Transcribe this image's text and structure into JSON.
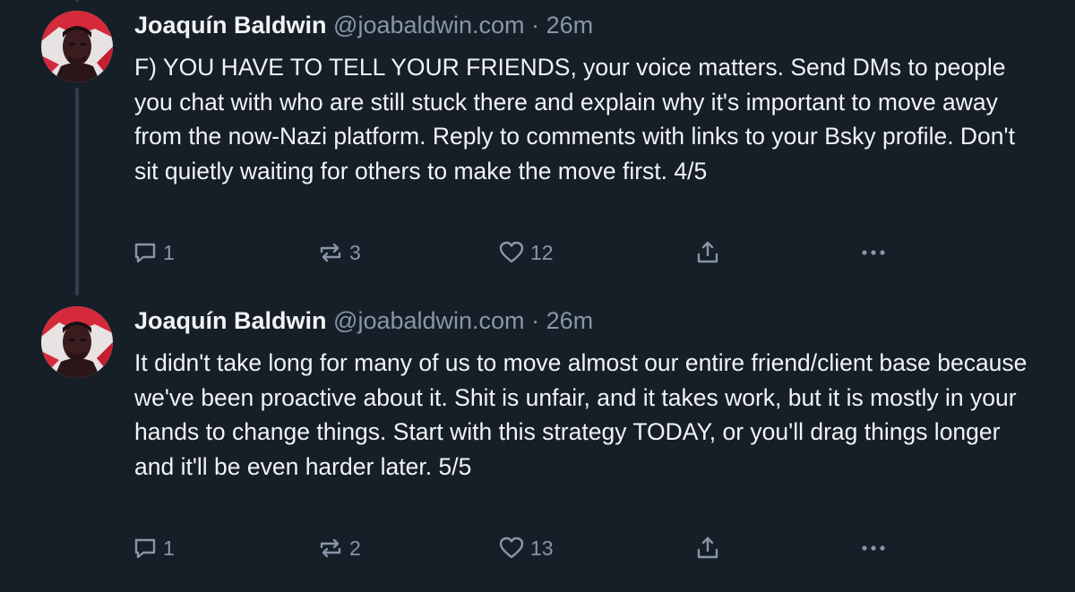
{
  "posts": [
    {
      "author": {
        "name": "Joaquín Baldwin",
        "handle": "@joabaldwin.com"
      },
      "separator": "·",
      "timestamp": "26m",
      "text": "F) YOU HAVE TO TELL YOUR FRIENDS, your voice matters. Send DMs to people you chat with who are still stuck there and explain why it's important to move away from the now-Nazi platform. Reply to comments with links to your Bsky profile. Don't sit quietly waiting for others to make the move first. 4/5",
      "counts": {
        "replies": "1",
        "reposts": "3",
        "likes": "12"
      },
      "icons": {
        "reply": "speech-bubble-icon",
        "repost": "repost-arrows-icon",
        "like": "heart-icon",
        "share": "share-upload-icon",
        "more": "ellipsis-icon"
      }
    },
    {
      "author": {
        "name": "Joaquín Baldwin",
        "handle": "@joabaldwin.com"
      },
      "separator": "·",
      "timestamp": "26m",
      "text": "It didn't take long for many of us to move almost our entire friend/client base because we've been proactive about it. Shit is unfair, and it takes work, but it is mostly in your hands to change things. Start with this strategy TODAY, or you'll drag things longer and it'll be even harder later. 5/5",
      "counts": {
        "replies": "1",
        "reposts": "2",
        "likes": "13"
      },
      "icons": {
        "reply": "speech-bubble-icon",
        "repost": "repost-arrows-icon",
        "like": "heart-icon",
        "share": "share-upload-icon",
        "more": "ellipsis-icon"
      }
    }
  ],
  "theme": {
    "background": "#161e27",
    "text": "#f1f3f5",
    "muted": "#8797a8",
    "thread_line": "#323e4c",
    "avatar_accent": "#d42a3c"
  }
}
